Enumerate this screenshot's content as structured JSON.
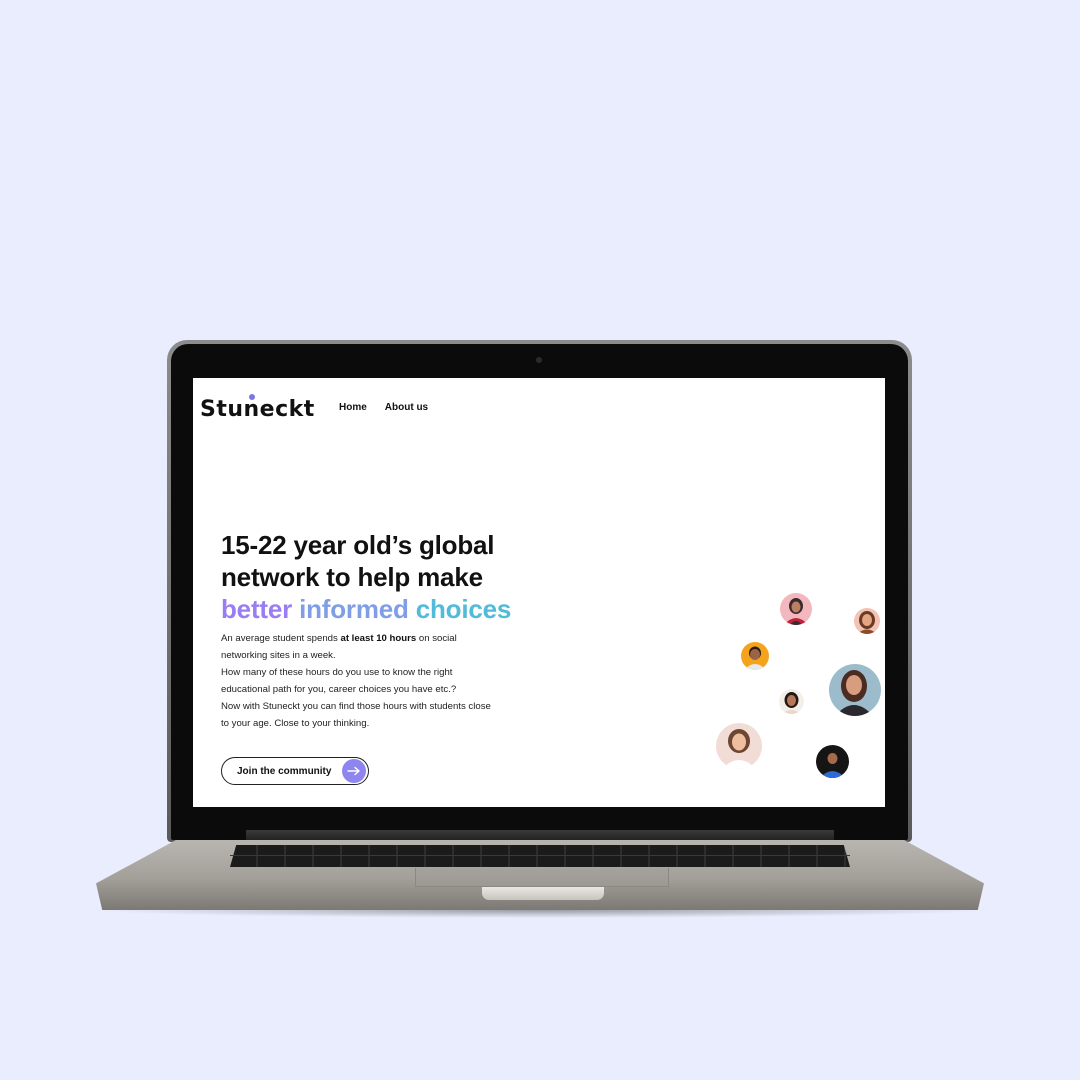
{
  "brand": {
    "name": "Stuneckt",
    "logo_text": "Stuneckt",
    "accent": "#8f85ef"
  },
  "nav": {
    "items": [
      {
        "label": "Home"
      },
      {
        "label": "About us"
      }
    ]
  },
  "hero": {
    "title_line_1": "15-22 year old’s global",
    "title_line_2": "network to help make",
    "title_word_1": "better",
    "title_word_2": "informed",
    "title_word_3": "choices",
    "body_lines": [
      "An average student spends ",
      "at least 10 hours",
      " on social networking sites in a week.",
      "How many of these hours do you use to know the right educational path for you, career choices you have etc.?",
      "Now with Stuneckt you can find those hours with students close to your age. Close to your thinking."
    ],
    "cta_label": "Join the community",
    "cta_icon": "arrow-right-icon"
  },
  "colors": {
    "page_background": "#eaedfd",
    "gradient_start": "#9a7ef1",
    "gradient_mid": "#7f9ee6",
    "gradient_end": "#52bbd8"
  }
}
